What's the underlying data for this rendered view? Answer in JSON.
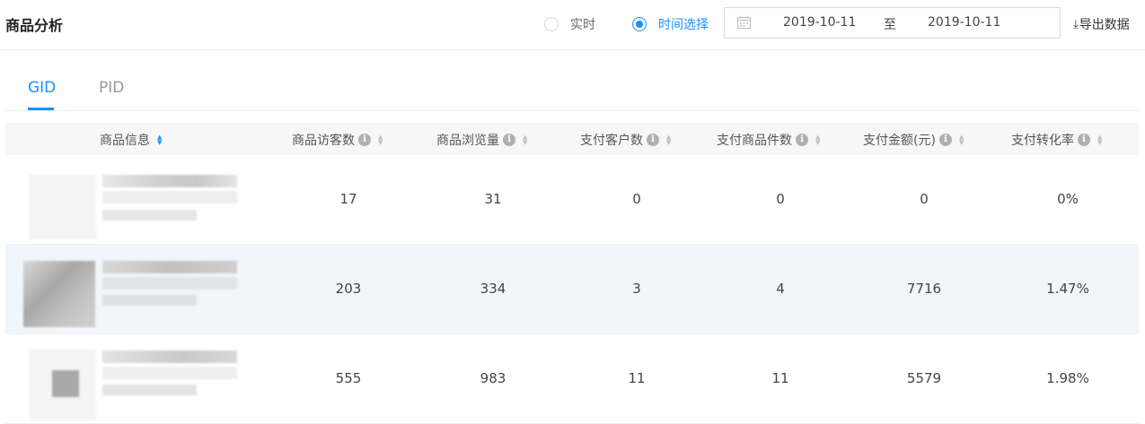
{
  "header": {
    "title": "商品分析",
    "radio_realtime": "实时",
    "radio_range": "时间选择",
    "start_date": "2019-10-11",
    "range_sep": "至",
    "end_date": "2019-10-11",
    "export_label": "导出数据",
    "accent_color": "#1890ff"
  },
  "tabs": [
    {
      "label": "GID",
      "active": true
    },
    {
      "label": "PID",
      "active": false
    }
  ],
  "table": {
    "columns": [
      "商品信息",
      "商品访客数",
      "商品浏览量",
      "支付客户数",
      "支付商品件数",
      "支付金额(元)",
      "支付转化率"
    ],
    "rows": [
      [
        "17",
        "31",
        "0",
        "0",
        "0",
        "0%"
      ],
      [
        "203",
        "334",
        "3",
        "4",
        "7716",
        "1.47%"
      ],
      [
        "555",
        "983",
        "11",
        "11",
        "5579",
        "1.98%"
      ]
    ]
  }
}
